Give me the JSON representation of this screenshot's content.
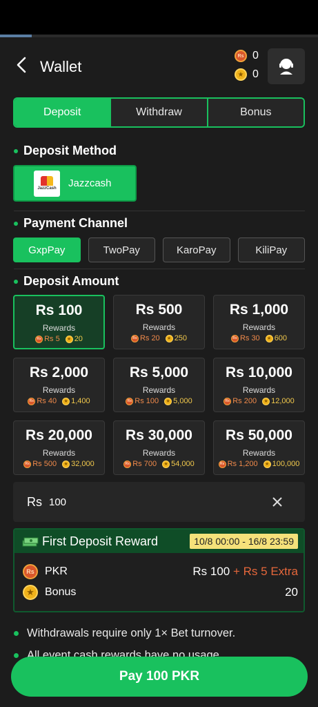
{
  "header": {
    "title": "Wallet",
    "cash_balance": "0",
    "bonus_balance": "0",
    "cash_currency_symbol": "Rs"
  },
  "tabs": [
    {
      "label": "Deposit",
      "active": true
    },
    {
      "label": "Withdraw",
      "active": false
    },
    {
      "label": "Bonus",
      "active": false
    }
  ],
  "deposit_method": {
    "section_title": "Deposit Method",
    "methods": [
      {
        "label": "Jazzcash",
        "logo_text": "JazzCash",
        "active": true
      }
    ]
  },
  "payment_channel": {
    "section_title": "Payment Channel",
    "channels": [
      {
        "label": "GxpPay",
        "active": true
      },
      {
        "label": "TwoPay",
        "active": false
      },
      {
        "label": "KaroPay",
        "active": false
      },
      {
        "label": "KiliPay",
        "active": false
      }
    ]
  },
  "deposit_amount": {
    "section_title": "Deposit Amount",
    "rewards_label": "Rewards",
    "options": [
      {
        "amount": "Rs 100",
        "cash_reward": "Rs 5",
        "bonus_reward": "20",
        "active": true
      },
      {
        "amount": "Rs 500",
        "cash_reward": "Rs 20",
        "bonus_reward": "250",
        "active": false
      },
      {
        "amount": "Rs 1,000",
        "cash_reward": "Rs 30",
        "bonus_reward": "600",
        "active": false
      },
      {
        "amount": "Rs 2,000",
        "cash_reward": "Rs 40",
        "bonus_reward": "1,400",
        "active": false
      },
      {
        "amount": "Rs 5,000",
        "cash_reward": "Rs 100",
        "bonus_reward": "5,000",
        "active": false
      },
      {
        "amount": "Rs 10,000",
        "cash_reward": "Rs 200",
        "bonus_reward": "12,000",
        "active": false
      },
      {
        "amount": "Rs 20,000",
        "cash_reward": "Rs 500",
        "bonus_reward": "32,000",
        "active": false
      },
      {
        "amount": "Rs 30,000",
        "cash_reward": "Rs 700",
        "bonus_reward": "54,000",
        "active": false
      },
      {
        "amount": "Rs 50,000",
        "cash_reward": "Rs 1,200",
        "bonus_reward": "100,000",
        "active": false
      }
    ]
  },
  "amount_input": {
    "prefix": "Rs",
    "value": "100"
  },
  "first_deposit_reward": {
    "title": "First Deposit Reward",
    "period": "10/8 00:00 - 16/8 23:59",
    "pkr_label": "PKR",
    "pkr_amount": "Rs 100",
    "pkr_extra": "+ Rs 5 Extra",
    "bonus_label": "Bonus",
    "bonus_amount": "20"
  },
  "notes": [
    "Withdrawals require only 1× Bet turnover.",
    "All event cash rewards have no usage"
  ],
  "pay_button": {
    "label": "Pay 100 PKR"
  },
  "colors": {
    "accent": "#19c15e",
    "background": "#1c1c1c",
    "card": "#262626",
    "extra_text": "#e5673b",
    "time_badge": "#f5e17a"
  }
}
